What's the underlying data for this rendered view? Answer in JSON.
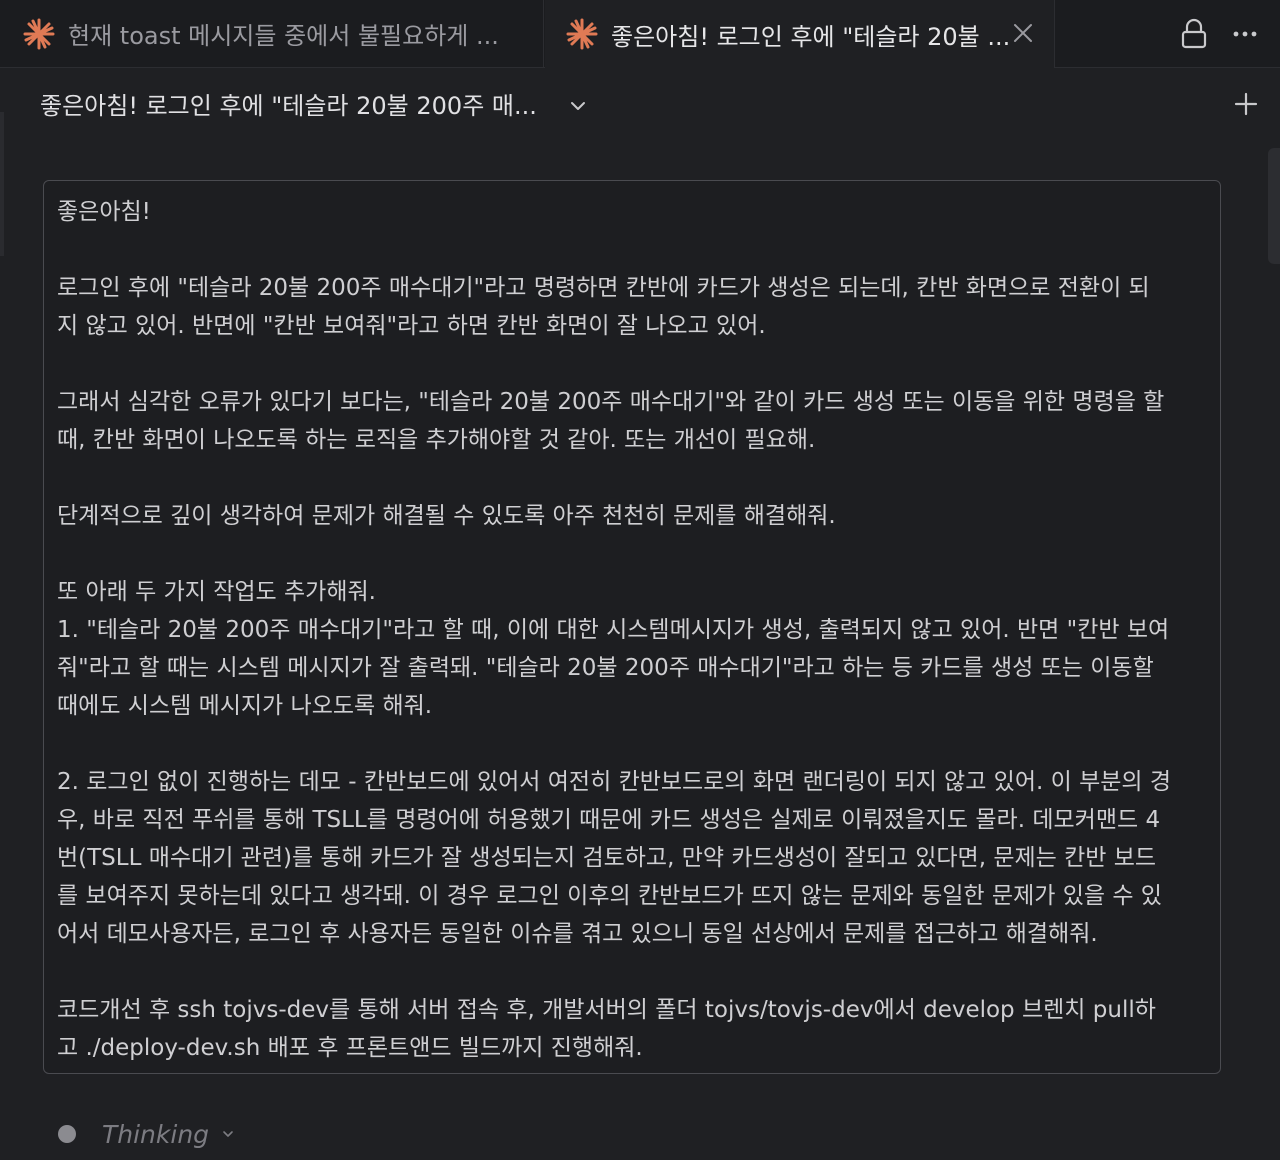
{
  "tabs": [
    {
      "label": "현재 toast 메시지들 중에서 불필요하게 ...",
      "active": false
    },
    {
      "label": "좋은아침! 로그인 후에 \"테슬라 20불 ...",
      "active": true
    }
  ],
  "header": {
    "title": "좋은아침! 로그인 후에 \"테슬라 20불 200주 매..."
  },
  "message": {
    "lines": [
      "좋은아침!",
      "",
      "로그인 후에 \"테슬라 20불 200주 매수대기\"라고 명령하면 칸반에 카드가 생성은 되는데, 칸반 화면으로 전환이 되",
      "지 않고 있어. 반면에 \"칸반 보여줘\"라고 하면 칸반 화면이 잘 나오고 있어.",
      "",
      "그래서 심각한 오류가 있다기 보다는, \"테슬라 20불 200주 매수대기\"와 같이 카드 생성 또는 이동을 위한 명령을 할",
      "때, 칸반 화면이 나오도록 하는 로직을 추가해야할 것 같아. 또는 개선이 필요해.",
      "",
      "단계적으로 깊이 생각하여 문제가 해결될 수 있도록 아주 천천히 문제를 해결해줘.",
      "",
      "또 아래 두 가지 작업도 추가해줘.",
      "1. \"테슬라 20불 200주 매수대기\"라고 할 때, 이에 대한 시스템메시지가 생성, 출력되지 않고 있어. 반면 \"칸반 보여",
      "줘\"라고 할 때는 시스템 메시지가 잘 출력돼. \"테슬라 20불 200주 매수대기\"라고 하는 등 카드를 생성 또는 이동할",
      "때에도 시스템 메시지가 나오도록 해줘.",
      "",
      "2. 로그인 없이 진행하는 데모 - 칸반보드에 있어서 여전히 칸반보드로의 화면 랜더링이 되지 않고 있어. 이 부분의 경",
      "우, 바로 직전 푸쉬를 통해 TSLL를 명령어에 허용했기 때문에 카드 생성은 실제로 이뤄졌을지도 몰라. 데모커맨드 4",
      "번(TSLL 매수대기 관련)를 통해 카드가 잘 생성되는지 검토하고, 만약 카드생성이 잘되고 있다면, 문제는 칸반 보드",
      "를 보여주지 못하는데 있다고 생각돼. 이 경우 로그인 이후의 칸반보드가 뜨지 않는 문제와 동일한 문제가 있을 수 있",
      "어서 데모사용자든, 로그인 후 사용자든 동일한 이슈를 겪고 있으니 동일 선상에서 문제를 접근하고 해결해줘.",
      "",
      "코드개선 후 ssh tojvs-dev를 통해 서버 접속 후, 개발서버의 폴더 tojvs/tovjs-dev에서 develop 브렌치 pull하",
      "고 ./deploy-dev.sh 배포 후 프론트앤드 빌드까지 진행해줘."
    ]
  },
  "status": {
    "thinking_label": "Thinking"
  },
  "icons": {
    "tab_icon": "claude-sparkle-icon",
    "accent_color": "#e07a55"
  }
}
